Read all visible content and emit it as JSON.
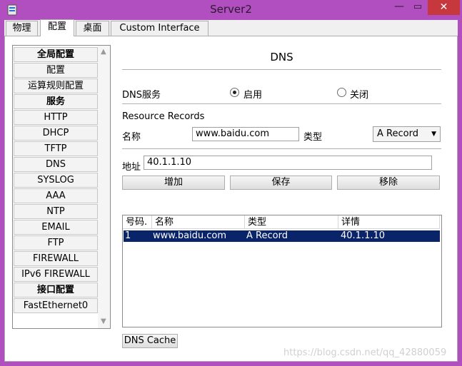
{
  "window": {
    "title": "Server2"
  },
  "controls": {
    "minimize": "—",
    "maximize": "▭",
    "close": "✕"
  },
  "tabs": [
    {
      "label": "物理"
    },
    {
      "label": "配置"
    },
    {
      "label": "桌面"
    },
    {
      "label": "Custom Interface"
    }
  ],
  "sidebar": {
    "items": [
      {
        "label": "全局配置",
        "header": true
      },
      {
        "label": "配置"
      },
      {
        "label": "运算规则配置"
      },
      {
        "label": "服务",
        "header": true
      },
      {
        "label": "HTTP"
      },
      {
        "label": "DHCP"
      },
      {
        "label": "TFTP"
      },
      {
        "label": "DNS"
      },
      {
        "label": "SYSLOG"
      },
      {
        "label": "AAA"
      },
      {
        "label": "NTP"
      },
      {
        "label": "EMAIL"
      },
      {
        "label": "FTP"
      },
      {
        "label": "FIREWALL"
      },
      {
        "label": "IPv6 FIREWALL"
      },
      {
        "label": "接口配置",
        "header": true
      },
      {
        "label": "FastEthernet0"
      }
    ]
  },
  "dns": {
    "title": "DNS",
    "service_label": "DNS服务",
    "on_label": "启用",
    "off_label": "关闭",
    "service_on": true,
    "records_label": "Resource Records",
    "name_label": "名称",
    "name_value": "www.baidu.com",
    "type_label": "类型",
    "type_value": "A Record",
    "address_label": "地址",
    "address_value": "40.1.1.10",
    "add_button": "增加",
    "save_button": "保存",
    "remove_button": "移除",
    "table": {
      "columns": [
        "号码.",
        "名称",
        "类型",
        "详情"
      ],
      "rows": [
        {
          "no": "1",
          "name": "www.baidu.com",
          "type": "A Record",
          "detail": "40.1.1.10"
        }
      ]
    },
    "cache_button": "DNS Cache"
  },
  "watermark": "https://blog.csdn.net/qq_42880059"
}
